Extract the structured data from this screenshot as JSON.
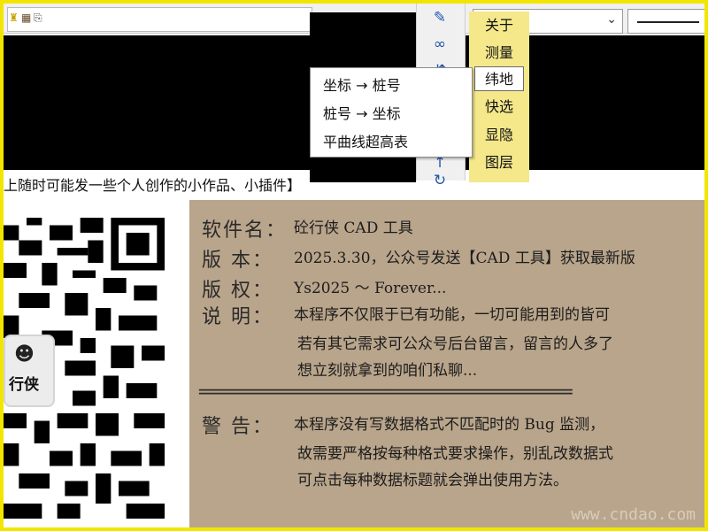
{
  "toolbar": {
    "icons": [
      "app-icon",
      "layer-icon",
      "file-icon"
    ],
    "dropdown_value": "",
    "linetype_label": ""
  },
  "tool_strip": {
    "icons": [
      "pencil-icon",
      "link-icon",
      "split-icon",
      "arrow-icon",
      "rotate-icon"
    ]
  },
  "side_menu": {
    "items": [
      "关于",
      "测量",
      "纬地",
      "快选",
      "显隐",
      "图层"
    ],
    "selected": "纬地"
  },
  "submenu": {
    "items": [
      "坐标 → 桩号",
      "桩号 → 坐标",
      "平曲线超高表"
    ]
  },
  "caption": "上随时可能发一些个人创作的小作品、小插件】",
  "qr": {
    "logo_text": "行侠",
    "logo_icon": "dinosaur-face-icon"
  },
  "info": {
    "software_label": "软件名：",
    "software_value": "砼行侠 CAD 工具",
    "version_label": "版  本：",
    "version_value": "2025.3.30，公众号发送【CAD 工具】获取最新版",
    "copyright_label": "版  权：",
    "copyright_value": "Ys2025 ～ Forever...",
    "notes_label": "说  明：",
    "notes_lines": [
      "本程序不仅限于已有功能，一切可能用到的皆可",
      "若有其它需求可公众号后台留言，留言的人多了",
      "想立刻就拿到的咱们私聊..."
    ],
    "divider": "==========================================",
    "warning_label": "警  告：",
    "warning_lines": [
      "本程序没有写数据格式不匹配时的 Bug 监测，",
      "故需要严格按每种格式要求操作，别乱改数据式",
      "可点击每种数据标题就会弹出使用方法。"
    ],
    "watermark": "www.cndao.com"
  }
}
